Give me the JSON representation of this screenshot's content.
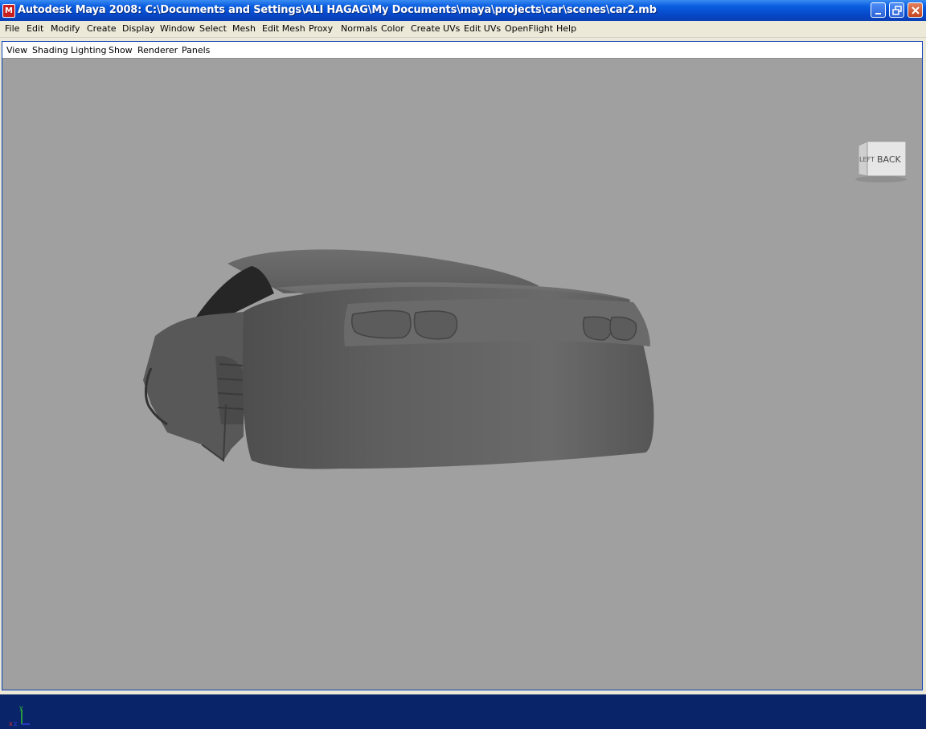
{
  "window": {
    "title": "Autodesk Maya 2008: C:\\Documents and Settings\\ALI HAGAG\\My Documents\\maya\\projects\\car\\scenes\\car2.mb",
    "app_icon_glyph": "M",
    "controls": [
      "minimize-icon",
      "restore-icon",
      "close-icon"
    ]
  },
  "menubar": {
    "items": [
      "File",
      "Edit",
      "Modify",
      "Create",
      "Display",
      "Window",
      "Select",
      "Mesh",
      "Edit Mesh",
      "Proxy",
      "Normals",
      "Color",
      "Create UVs",
      "Edit UVs",
      "OpenFlight",
      "Help"
    ]
  },
  "panel": {
    "menu": [
      "View",
      "Shading",
      "Lighting",
      "Show",
      "Renderer",
      "Panels"
    ]
  },
  "viewcube": {
    "front_label": "BACK",
    "side_label": "LEFT"
  },
  "axis": {
    "x_label": "x",
    "y_label": "y",
    "z_label": "z",
    "x_color": "#e03030",
    "y_color": "#30c030",
    "z_color": "#3040e0"
  },
  "colors": {
    "viewport_bg": "#a0a0a0",
    "titlebar": "#0a5de0",
    "menubar_bg": "#ece9d8"
  }
}
